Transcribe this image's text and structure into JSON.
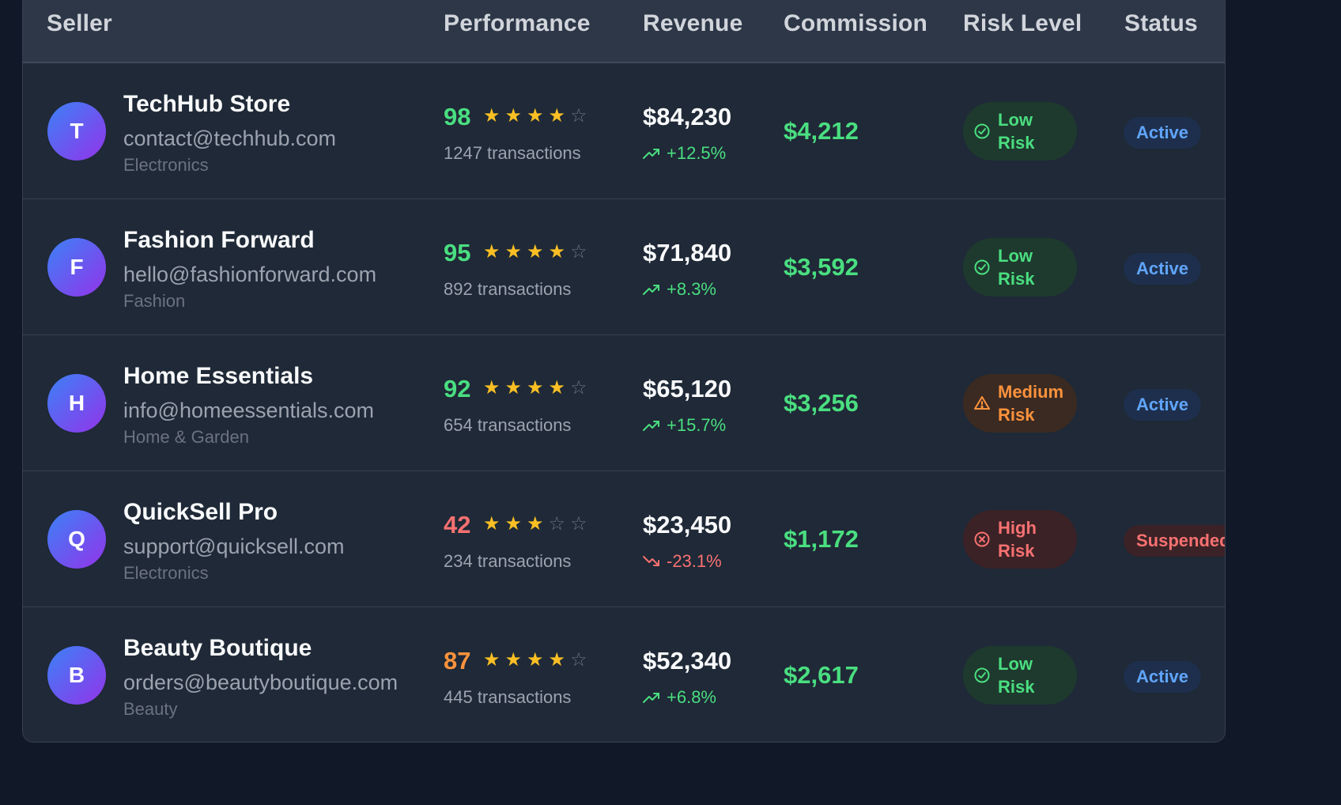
{
  "table": {
    "headers": {
      "seller": "Seller",
      "performance": "Performance",
      "revenue": "Revenue",
      "commission": "Commission",
      "risk": "Risk Level",
      "status": "Status"
    },
    "rows": [
      {
        "initial": "T",
        "name": "TechHub Store",
        "email": "contact@techhub.com",
        "category": "Electronics",
        "score": "98",
        "score_color": "green",
        "stars": 4,
        "transactions": "1247 transactions",
        "revenue": "$84,230",
        "trend": "+12.5%",
        "trend_dir": "up",
        "commission": "$4,212",
        "risk_line1": "Low",
        "risk_line2": "Risk",
        "risk_level": "low",
        "status": "Active",
        "status_type": "active"
      },
      {
        "initial": "F",
        "name": "Fashion Forward",
        "email": "hello@fashionforward.com",
        "category": "Fashion",
        "score": "95",
        "score_color": "green",
        "stars": 4,
        "transactions": "892 transactions",
        "revenue": "$71,840",
        "trend": "+8.3%",
        "trend_dir": "up",
        "commission": "$3,592",
        "risk_line1": "Low",
        "risk_line2": "Risk",
        "risk_level": "low",
        "status": "Active",
        "status_type": "active"
      },
      {
        "initial": "H",
        "name": "Home Essentials",
        "email": "info@homeessentials.com",
        "category": "Home & Garden",
        "score": "92",
        "score_color": "green",
        "stars": 4,
        "transactions": "654 transactions",
        "revenue": "$65,120",
        "trend": "+15.7%",
        "trend_dir": "up",
        "commission": "$3,256",
        "risk_line1": "Medium",
        "risk_line2": "Risk",
        "risk_level": "medium",
        "status": "Active",
        "status_type": "active"
      },
      {
        "initial": "Q",
        "name": "QuickSell Pro",
        "email": "support@quicksell.com",
        "category": "Electronics",
        "score": "42",
        "score_color": "red",
        "stars": 3,
        "transactions": "234 transactions",
        "revenue": "$23,450",
        "trend": "-23.1%",
        "trend_dir": "down",
        "commission": "$1,172",
        "risk_line1": "High",
        "risk_line2": "Risk",
        "risk_level": "high",
        "status": "Suspended",
        "status_type": "suspended"
      },
      {
        "initial": "B",
        "name": "Beauty Boutique",
        "email": "orders@beautyboutique.com",
        "category": "Beauty",
        "score": "87",
        "score_color": "orange",
        "stars": 4,
        "transactions": "445 transactions",
        "revenue": "$52,340",
        "trend": "+6.8%",
        "trend_dir": "up",
        "commission": "$2,617",
        "risk_line1": "Low",
        "risk_line2": "Risk",
        "risk_level": "low",
        "status": "Active",
        "status_type": "active"
      }
    ],
    "max_stars": 5,
    "icons": {
      "star": "star-icon",
      "trend_up": "trending-up-icon",
      "trend_down": "trending-down-icon",
      "risk_low": "check-circle-icon",
      "risk_medium": "warning-triangle-icon",
      "risk_high": "x-circle-icon"
    },
    "colors": {
      "green": "#4ade80",
      "red": "#f87171",
      "orange": "#fb923c",
      "star": "#fbbf24",
      "active": "#60a5fa"
    }
  }
}
